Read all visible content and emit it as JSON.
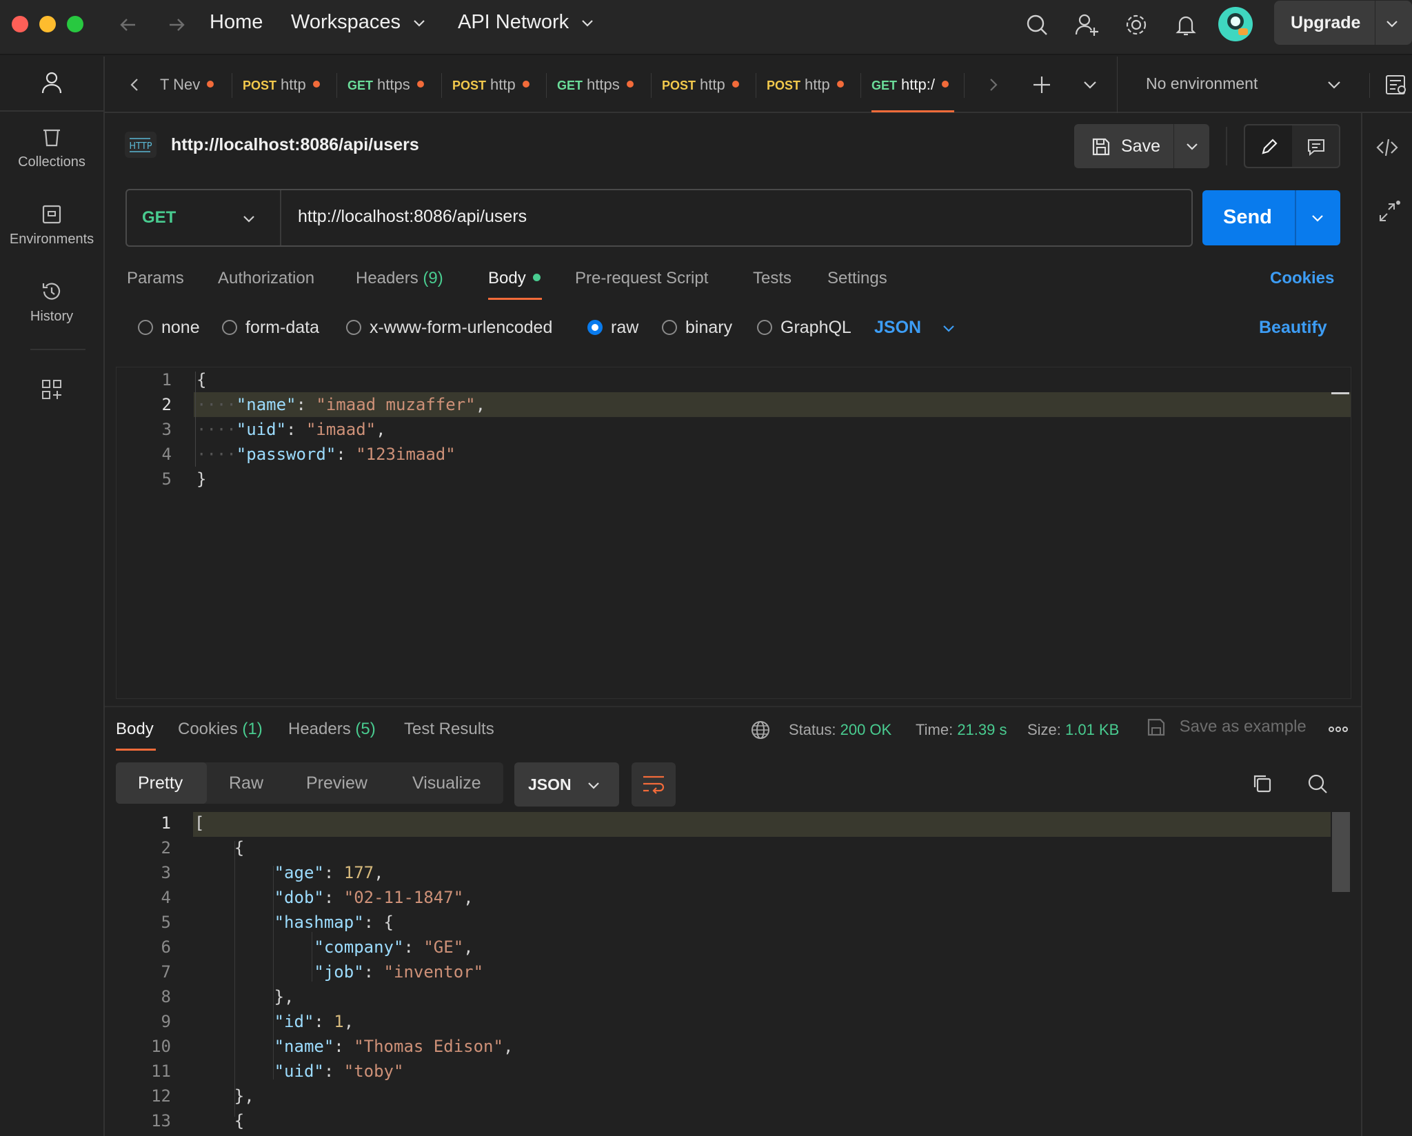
{
  "nav": {
    "home": "Home",
    "workspaces": "Workspaces",
    "api_network": "API Network",
    "upgrade": "Upgrade"
  },
  "sidebar": {
    "collections": "Collections",
    "environments": "Environments",
    "history": "History"
  },
  "tabs": [
    {
      "method": "",
      "label": "T Nev"
    },
    {
      "method": "POST",
      "label": "http"
    },
    {
      "method": "GET",
      "label": "https"
    },
    {
      "method": "POST",
      "label": "http"
    },
    {
      "method": "GET",
      "label": "https"
    },
    {
      "method": "POST",
      "label": "http"
    },
    {
      "method": "POST",
      "label": "http"
    },
    {
      "method": "GET",
      "label": "http:/"
    }
  ],
  "environment": "No environment",
  "request": {
    "title": "http://localhost:8086/api/users",
    "save": "Save",
    "method": "GET",
    "url": "http://localhost:8086/api/users",
    "send": "Send"
  },
  "request_tabs": {
    "params": "Params",
    "authorization": "Authorization",
    "headers": "Headers",
    "headers_count": "(9)",
    "body": "Body",
    "prerequest": "Pre-request Script",
    "tests": "Tests",
    "settings": "Settings",
    "cookies": "Cookies"
  },
  "body_types": {
    "none": "none",
    "form_data": "form-data",
    "urlencoded": "x-www-form-urlencoded",
    "raw": "raw",
    "binary": "binary",
    "graphql": "GraphQL",
    "format": "JSON",
    "beautify": "Beautify"
  },
  "request_body": {
    "line_numbers": [
      "1",
      "2",
      "3",
      "4",
      "5"
    ],
    "name_key": "\"name\"",
    "name_val": "\"imaad muzaffer\"",
    "uid_key": "\"uid\"",
    "uid_val": "\"imaad\"",
    "password_key": "\"password\"",
    "password_val": "\"123imaad\""
  },
  "response": {
    "tabs": {
      "body": "Body",
      "cookies": "Cookies",
      "cookies_count": "(1)",
      "headers": "Headers",
      "headers_count": "(5)",
      "test_results": "Test Results"
    },
    "status_label": "Status:",
    "status_value": "200 OK",
    "time_label": "Time:",
    "time_value": "21.39 s",
    "size_label": "Size:",
    "size_value": "1.01 KB",
    "save_example": "Save as example",
    "views": {
      "pretty": "Pretty",
      "raw": "Raw",
      "preview": "Preview",
      "visualize": "Visualize",
      "format": "JSON"
    },
    "line_numbers": [
      "1",
      "2",
      "3",
      "4",
      "5",
      "6",
      "7",
      "8",
      "9",
      "10",
      "11",
      "12",
      "13"
    ],
    "body": {
      "age_key": "\"age\"",
      "age_val": "177",
      "dob_key": "\"dob\"",
      "dob_val": "\"02-11-1847\"",
      "hashmap_key": "\"hashmap\"",
      "company_key": "\"company\"",
      "company_val": "\"GE\"",
      "job_key": "\"job\"",
      "job_val": "\"inventor\"",
      "id_key": "\"id\"",
      "id_val": "1",
      "name_key": "\"name\"",
      "name_val": "\"Thomas Edison\"",
      "uid_key": "\"uid\"",
      "uid_val": "\"toby\""
    }
  },
  "colors": {
    "accent": "#097bed",
    "success": "#49cc90",
    "unsaved_dot": "#f26b3a",
    "link": "#3d9df5"
  }
}
